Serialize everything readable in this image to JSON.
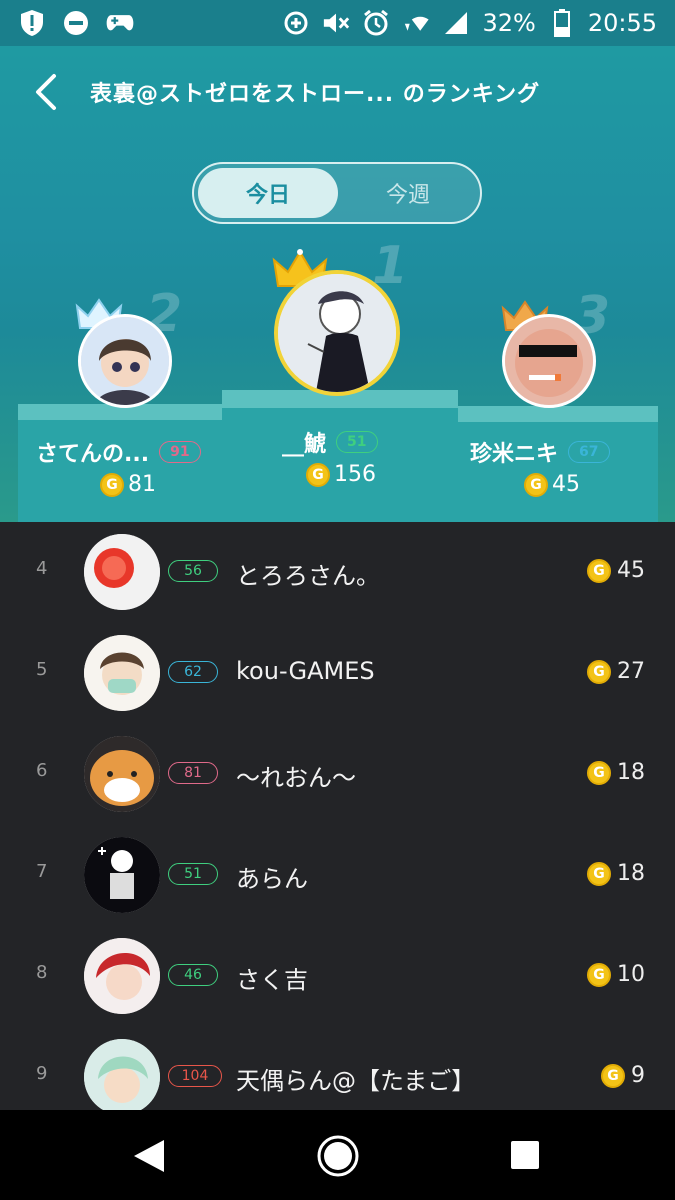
{
  "status_bar": {
    "battery": "32%",
    "time": "20:55"
  },
  "header": {
    "title": "表裏@ストゼロをストロー... のランキング",
    "tabs": {
      "today": "今日",
      "week": "今週"
    }
  },
  "podium": {
    "first": {
      "rank": "1",
      "name": "__鯱",
      "level": "51",
      "coins": "156"
    },
    "second": {
      "rank": "2",
      "name": "さてんの...",
      "level": "91",
      "coins": "81"
    },
    "third": {
      "rank": "3",
      "name": "珍米ニキ",
      "level": "67",
      "coins": "45"
    }
  },
  "ranking": [
    {
      "rank": "4",
      "level": "56",
      "name": "とろろさん。",
      "coins": "45"
    },
    {
      "rank": "5",
      "level": "62",
      "name": "kou-GAMES",
      "coins": "27"
    },
    {
      "rank": "6",
      "level": "81",
      "name": "〜れおん〜",
      "coins": "18"
    },
    {
      "rank": "7",
      "level": "51",
      "name": "あらん",
      "coins": "18"
    },
    {
      "rank": "8",
      "level": "46",
      "name": "さく吉",
      "coins": "10"
    },
    {
      "rank": "9",
      "level": "104",
      "name": "天偶らん@【たまご】",
      "coins": "9"
    }
  ],
  "coin_symbol": "G",
  "colors": {
    "header_teal": "#1f9aa2",
    "level_green": "#3fcf7f",
    "level_blue": "#3ab5d8",
    "level_pink": "#e06a8a",
    "level_red": "#e8564a",
    "coin_gold": "#f3c317",
    "list_bg": "#232427"
  }
}
